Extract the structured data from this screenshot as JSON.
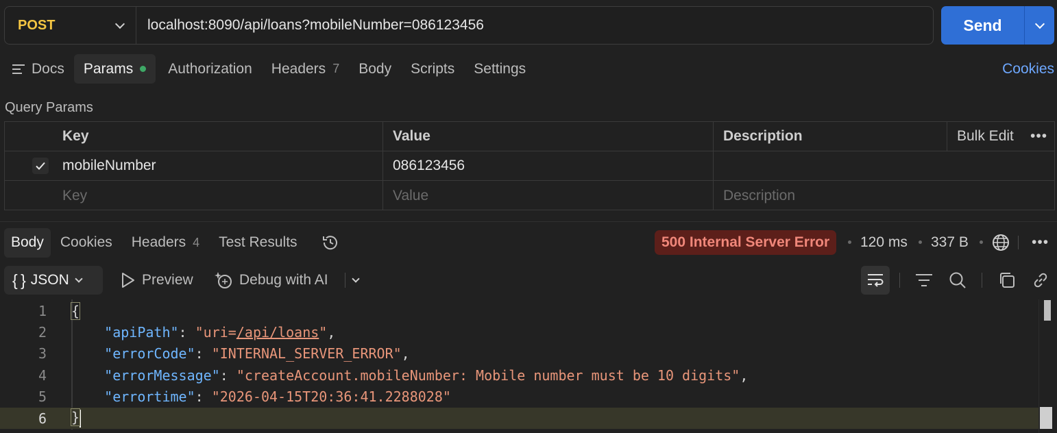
{
  "request": {
    "method": "POST",
    "url": "localhost:8090/api/loans?mobileNumber=086123456",
    "send_label": "Send"
  },
  "request_tabs": [
    {
      "label": "Docs"
    },
    {
      "label": "Params",
      "active": true,
      "indicator": "green-dot"
    },
    {
      "label": "Authorization"
    },
    {
      "label": "Headers",
      "count": "7"
    },
    {
      "label": "Body"
    },
    {
      "label": "Scripts"
    },
    {
      "label": "Settings"
    }
  ],
  "cookies_link": "Cookies",
  "query_params": {
    "title": "Query Params",
    "headers": {
      "key": "Key",
      "value": "Value",
      "description": "Description",
      "bulk_edit": "Bulk Edit"
    },
    "rows": [
      {
        "checked": true,
        "key": "mobileNumber",
        "value": "086123456",
        "description": ""
      }
    ],
    "placeholder": {
      "key": "Key",
      "value": "Value",
      "description": "Description"
    }
  },
  "response_tabs": [
    {
      "label": "Body",
      "active": true
    },
    {
      "label": "Cookies"
    },
    {
      "label": "Headers",
      "count": "4"
    },
    {
      "label": "Test Results"
    }
  ],
  "response_meta": {
    "status": "500 Internal Server Error",
    "time": "120 ms",
    "size": "337 B"
  },
  "response_toolbar": {
    "format": "JSON",
    "format_icon": "{ }",
    "preview": "Preview",
    "debug": "Debug with AI"
  },
  "response_body": {
    "line_numbers": [
      "1",
      "2",
      "3",
      "4",
      "5",
      "6"
    ],
    "apiPath_key": "\"apiPath\"",
    "apiPath_prefix": "\"uri=",
    "apiPath_link": "/api/loans",
    "apiPath_suffix": "\"",
    "errorCode_key": "\"errorCode\"",
    "errorCode_value": "\"INTERNAL_SERVER_ERROR\"",
    "errorMessage_key": "\"errorMessage\"",
    "errorMessage_value": "\"createAccount.mobileNumber: Mobile number must be 10 digits\"",
    "errortime_key": "\"errortime\"",
    "errortime_value": "\"2026-04-15T20:36:41.2288028\"",
    "open_brace": "{",
    "close_brace": "}"
  },
  "colors": {
    "accent": "#2f6fd6",
    "method": "#f4c542",
    "error_badge_bg": "#5c1f1a",
    "error_badge_text": "#f0877a",
    "json_key": "#6fb6ff",
    "json_string": "#e9967a",
    "link": "#6ea8ff",
    "active_dot": "#3ea866"
  }
}
